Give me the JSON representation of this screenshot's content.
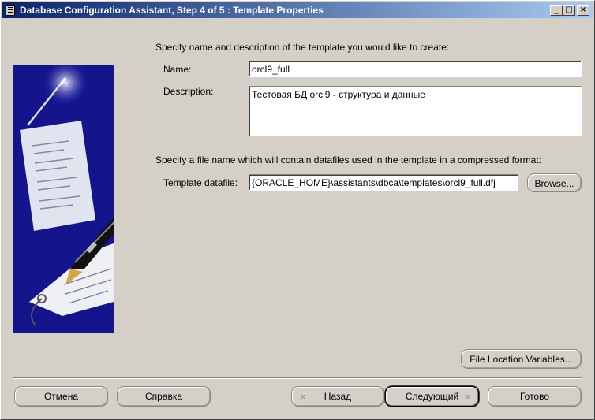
{
  "window": {
    "title": "Database Configuration Assistant, Step 4 of 5 : Template Properties",
    "controls": {
      "minimize": "_",
      "maximize": "□",
      "close": "×"
    }
  },
  "form": {
    "intro": "Specify name and description of the template you would like to create:",
    "name_label": "Name:",
    "name_value": "orcl9_full",
    "description_label": "Description:",
    "description_value": "Тестовая БД orcl9 - структура и данные",
    "datafile_intro": "Specify a file name which will contain datafiles used in the template in a compressed format:",
    "datafile_label": "Template datafile:",
    "datafile_value": "{ORACLE_HOME}\\assistants\\dbca\\templates\\orcl9_full.dfj",
    "browse_label": "Browse...",
    "file_location_label": "File Location Variables..."
  },
  "footer": {
    "cancel_label": "Отмена",
    "help_label": "Справка",
    "back_label": "Назад",
    "next_label": "Следующий",
    "finish_label": "Готово"
  },
  "colors": {
    "panel": "#d4d0c8",
    "titlebar": "#0a246a",
    "art_bg": "#14148c"
  }
}
